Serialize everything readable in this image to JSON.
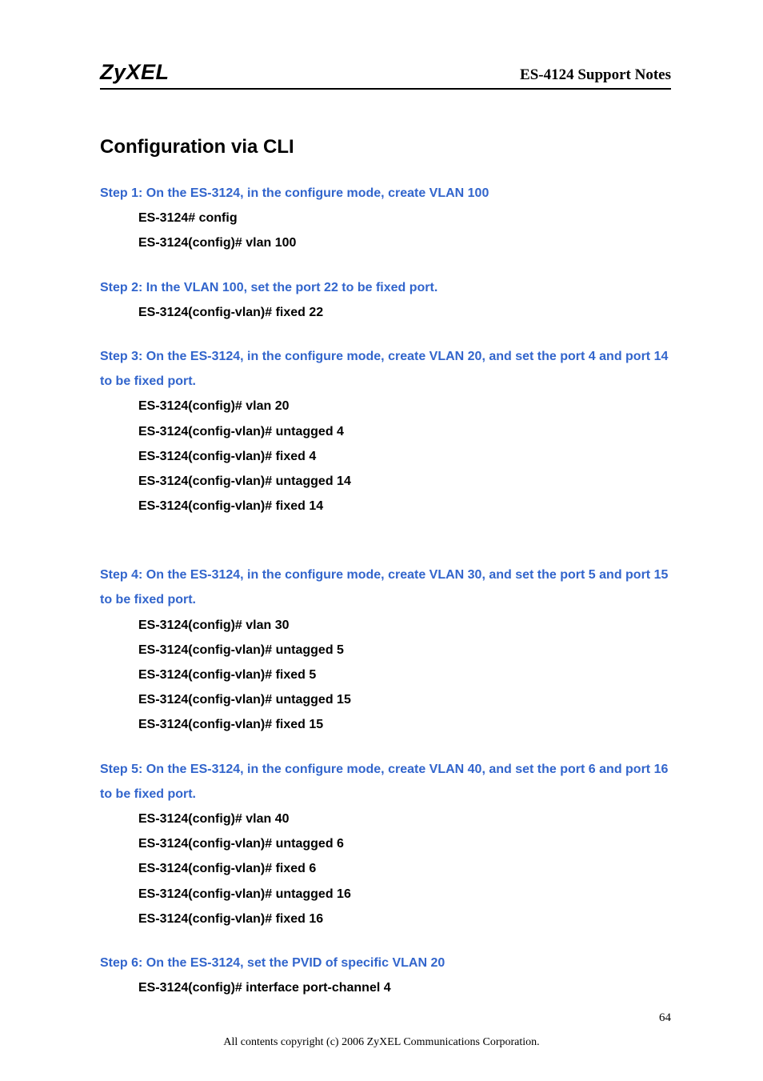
{
  "header": {
    "brand": "ZyXEL",
    "doc_title": "ES-4124 Support Notes"
  },
  "section_heading": "Configuration via CLI",
  "steps": [
    {
      "label": "Step 1: On the ES-3124, in the configure mode, create VLAN 100",
      "commands": [
        "ES-3124# config",
        "ES-3124(config)# vlan 100"
      ],
      "gap": "normal"
    },
    {
      "label": "Step 2: In the VLAN 100, set the port 22 to be fixed port.",
      "commands": [
        "ES-3124(config-vlan)# fixed 22"
      ],
      "gap": "normal"
    },
    {
      "label": "Step 3: On the ES-3124, in the configure mode, create VLAN 20, and set the port 4 and port 14 to be fixed port.",
      "commands": [
        "ES-3124(config)# vlan 20",
        "ES-3124(config-vlan)# untagged 4",
        "ES-3124(config-vlan)# fixed 4",
        "ES-3124(config-vlan)# untagged 14",
        "ES-3124(config-vlan)# fixed 14"
      ],
      "gap": "large"
    },
    {
      "label": "Step 4: On the ES-3124, in the configure mode, create VLAN 30, and set the port 5 and port 15 to be fixed port.",
      "commands": [
        "ES-3124(config)# vlan 30",
        "ES-3124(config-vlan)# untagged 5",
        "ES-3124(config-vlan)# fixed 5",
        "ES-3124(config-vlan)# untagged 15",
        "ES-3124(config-vlan)# fixed 15"
      ],
      "gap": "normal"
    },
    {
      "label": "Step 5: On the ES-3124, in the configure mode, create VLAN 40, and set the port 6 and port 16 to be fixed port.",
      "commands": [
        "ES-3124(config)# vlan 40",
        "ES-3124(config-vlan)# untagged 6",
        "ES-3124(config-vlan)# fixed 6",
        "ES-3124(config-vlan)# untagged 16",
        "ES-3124(config-vlan)# fixed 16"
      ],
      "gap": "normal"
    },
    {
      "label": "Step 6: On the ES-3124, set the PVID of specific VLAN 20",
      "commands": [
        "ES-3124(config)# interface port-channel 4"
      ],
      "gap": "normal"
    }
  ],
  "page_number": "64",
  "footer": "All contents copyright (c) 2006 ZyXEL Communications Corporation."
}
